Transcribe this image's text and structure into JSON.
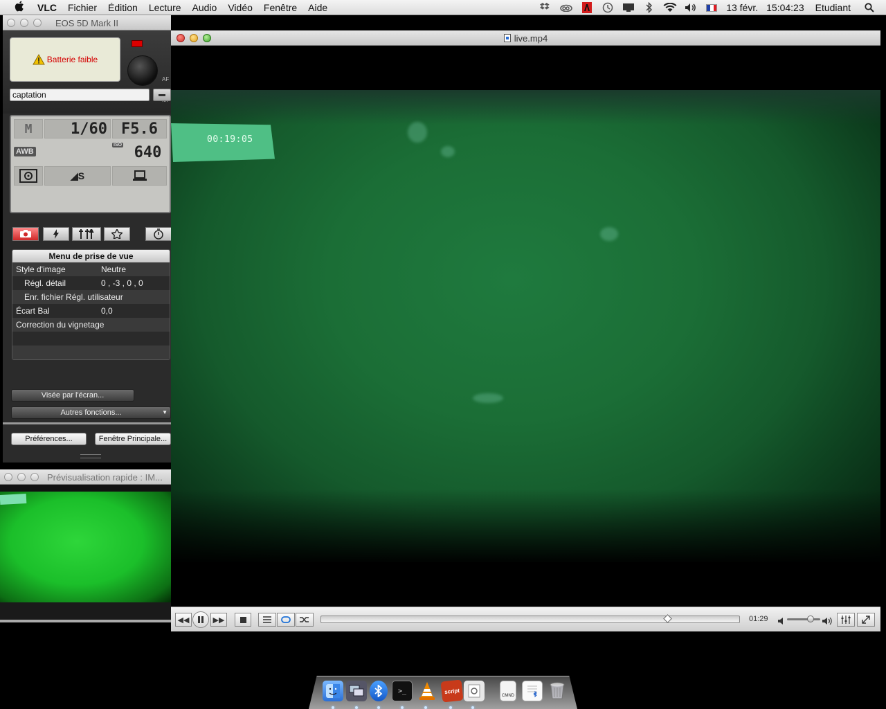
{
  "menubar": {
    "apple": "",
    "app": "VLC",
    "menus": [
      "Fichier",
      "Édition",
      "Lecture",
      "Audio",
      "Vidéo",
      "Fenêtre",
      "Aide"
    ],
    "date": "13 févr.",
    "time": "15:04:23",
    "user": "Etudiant",
    "status_icons": [
      "dropbox-icon",
      "creative-cloud-icon",
      "adobe-icon",
      "time-machine-icon",
      "display-icon",
      "bluetooth-icon",
      "wifi-icon",
      "volume-icon",
      "france-flag-icon",
      "spotlight-icon"
    ]
  },
  "eos": {
    "title": "EOS 5D Mark II",
    "warning": "Batterie faible",
    "caption": "captation",
    "side_labels": [
      "AF",
      "MF"
    ],
    "lcd": {
      "mode": "M",
      "shutter": "1/60",
      "aperture": "F5.6",
      "wb": "AWB",
      "iso_label": "ISO",
      "iso": "640",
      "quality": "◢S"
    },
    "tabs": [
      "camera-tab",
      "flash-tab",
      "tools-tab",
      "star-tab",
      "timer-tab"
    ],
    "shoot_menu": {
      "title": "Menu de prise de vue",
      "rows": [
        {
          "key": "Style d'image",
          "value": "Neutre",
          "indent": false
        },
        {
          "key": "Régl. détail",
          "value": "0 , -3 , 0 , 0",
          "indent": true
        },
        {
          "key": "Enr. fichier Régl. utilisateur",
          "value": "",
          "indent": true
        },
        {
          "key": "Écart Bal",
          "value": "0,0",
          "indent": false
        },
        {
          "key": "Correction du vignetage",
          "value": "",
          "indent": false
        }
      ]
    },
    "buttons": {
      "live_view": "Visée par l'écran...",
      "other_functions": "Autres fonctions...",
      "preferences": "Préférences...",
      "main_window": "Fenêtre Principale..."
    }
  },
  "preview": {
    "title": "Prévisualisation rapide : IM..."
  },
  "vlc": {
    "title": "live.mp4",
    "tape_timecode": "00:19:05",
    "elapsed": "01:29",
    "progress_fraction": 0.83,
    "volume_fraction": 0.7
  },
  "dock": {
    "apps": [
      "finder-icon",
      "remote-desktop-icon",
      "bluetooth-icon",
      "terminal-icon",
      "vlc-icon",
      "script-editor-icon",
      "preview-icon",
      "cmnd-document-icon",
      "bluetooth-document-icon",
      "trash-icon"
    ]
  }
}
